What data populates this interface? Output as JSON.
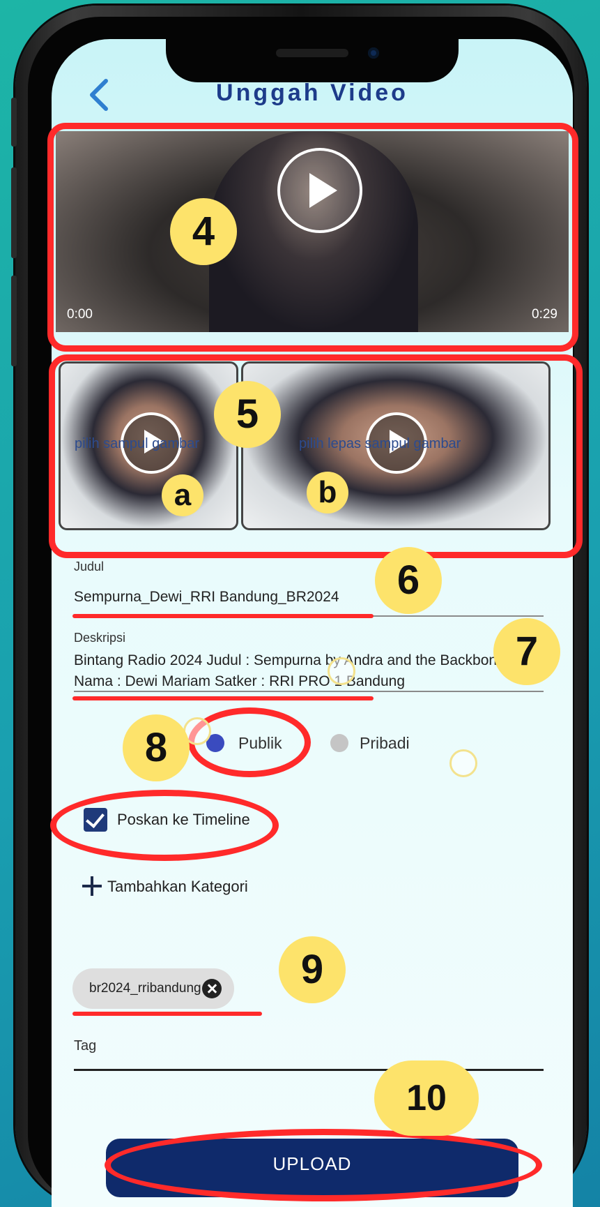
{
  "header": {
    "title": "Unggah Video"
  },
  "video": {
    "time_start": "0:00",
    "time_end": "0:29"
  },
  "thumbnails": {
    "cover_label": "pilih sampul gambar",
    "loose_label": "pilih lepas sampul gambar"
  },
  "form": {
    "title_label": "Judul",
    "title_value": "Sempurna_Dewi_RRI Bandung_BR2024",
    "desc_label": "Deskripsi",
    "desc_value": "Bintang Radio 2024 Judul : Sempurna by Andra and the Backbone Nama : Dewi Mariam Satker : RRI PRO 1 Bandung",
    "visibility": {
      "public_label": "Publik",
      "private_label": "Pribadi",
      "selected": "Publik"
    },
    "post_timeline_label": "Poskan ke Timeline",
    "post_timeline_checked": true,
    "add_category_label": "Tambahkan Kategori",
    "category_chip": "br2024_rribandung",
    "tag_label": "Tag",
    "upload_label": "UPLOAD"
  },
  "annotations": {
    "n4": "4",
    "n5": "5",
    "na": "a",
    "nb": "b",
    "n6": "6",
    "n7": "7",
    "n8": "8",
    "n9": "9",
    "n10": "10"
  },
  "colors": {
    "accent": "#1d3b8a",
    "annotation": "#ff2a2a",
    "badge": "#fde36b",
    "upload": "#0f2a6b"
  }
}
